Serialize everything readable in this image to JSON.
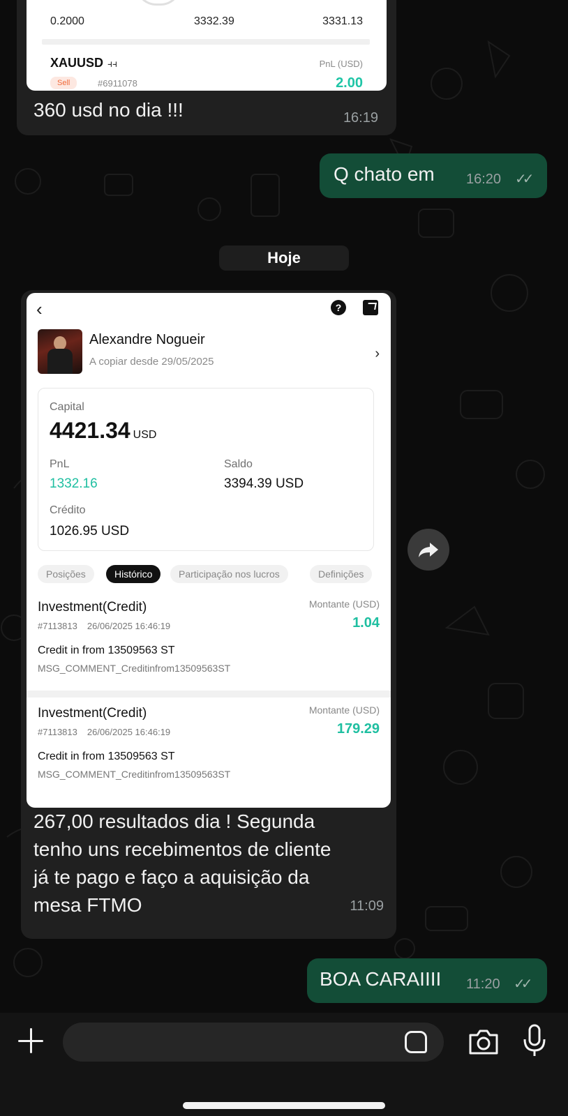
{
  "messages": {
    "m1": {
      "card": {
        "row": [
          "0.2000",
          "3332.39",
          "3331.13"
        ],
        "symbol": "XAUUSD",
        "symbol_icon": "candlestick-icon",
        "side": "Sell",
        "ticket": "#6911078",
        "pnl_label": "PnL (USD)",
        "pnl_value": "2.00"
      },
      "text": "360 usd no dia !!!",
      "time": "16:19"
    },
    "m2": {
      "text": "Q chato em",
      "time": "16:20",
      "status": "read-ticks"
    },
    "day_separator": "Hoje",
    "m3": {
      "card": {
        "trader_name": "Alexandre Nogueir",
        "copy_since": "A copiar desde 29/05/2025",
        "capital_label": "Capital",
        "capital_value": "4421.34",
        "capital_unit": "USD",
        "pnl_label": "PnL",
        "pnl_value": "1332.16",
        "saldo_label": "Saldo",
        "saldo_value": "3394.39 USD",
        "credito_label": "Crédito",
        "credito_value": "1026.95 USD",
        "tabs": [
          "Posições",
          "Histórico",
          "Participação nos lucros",
          "Definições"
        ],
        "active_tab": "Histórico",
        "entries": [
          {
            "title": "Investment(Credit)",
            "amount_label": "Montante (USD)",
            "amount": "1.04",
            "ticket": "#7113813",
            "datetime": "26/06/2025 16:46:19",
            "desc": "Credit in from 13509563 ST",
            "comment": "MSG_COMMENT_Creditinfrom13509563ST"
          },
          {
            "title": "Investment(Credit)",
            "amount_label": "Montante (USD)",
            "amount": "179.29",
            "ticket": "#7113813",
            "datetime": "26/06/2025 16:46:19",
            "desc": "Credit in from 13509563 ST",
            "comment": "MSG_COMMENT_Creditinfrom13509563ST"
          }
        ]
      },
      "text_lines": [
        "267,00 resultados dia ! Segunda",
        "tenho uns recebimentos de cliente",
        "já te pago e faço a aquisição da",
        "mesa FTMO"
      ],
      "time": "11:09"
    },
    "m4": {
      "text": "BOA CARAIIII",
      "time": "11:20",
      "status": "read-ticks"
    }
  },
  "input": {
    "placeholder": ""
  },
  "colors": {
    "incoming": "#202020",
    "outgoing": "#134d37",
    "accent_green": "#1fbfa1"
  }
}
